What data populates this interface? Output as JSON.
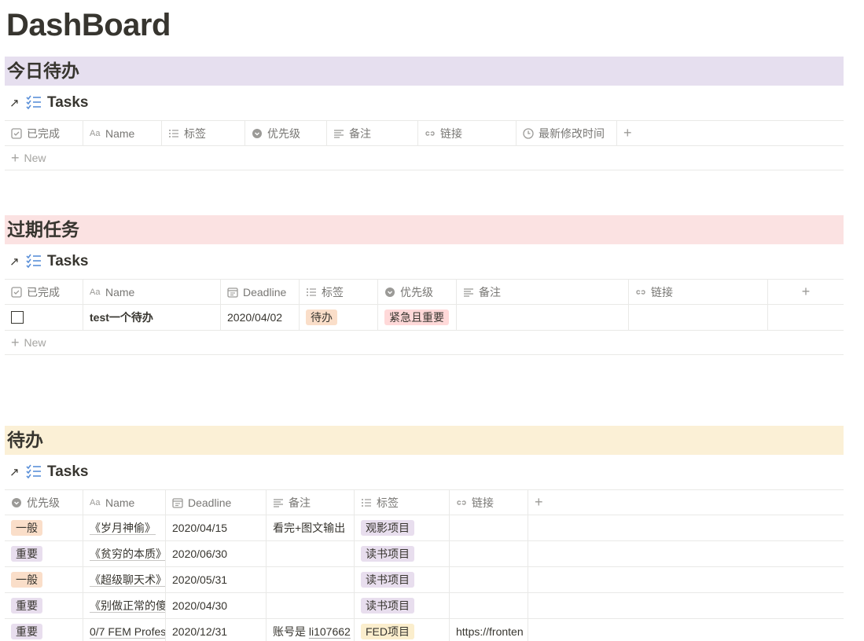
{
  "page_title": "DashBoard",
  "colors": {
    "today_bg": "#e6dfef",
    "overdue_bg": "#fbe2e2",
    "todo_bg": "#fbf0d6",
    "tag_orange": "#fadec9",
    "tag_purple": "#e8deee",
    "tag_pink": "#ffd9d9",
    "tag_yellow": "#fbeecd"
  },
  "sections": {
    "today": {
      "header": "今日待办",
      "db_title": "Tasks",
      "columns": [
        "已完成",
        "Name",
        "标签",
        "优先级",
        "备注",
        "链接",
        "最新修改时间"
      ],
      "new_label": "New"
    },
    "overdue": {
      "header": "过期任务",
      "db_title": "Tasks",
      "columns": [
        "已完成",
        "Name",
        "Deadline",
        "标签",
        "优先级",
        "备注",
        "链接"
      ],
      "rows": [
        {
          "done": false,
          "name": "test一个待办",
          "deadline": "2020/04/02",
          "tag": "待办",
          "priority": "紧急且重要",
          "note": "",
          "link": ""
        }
      ],
      "new_label": "New"
    },
    "todo": {
      "header": "待办",
      "db_title": "Tasks",
      "columns": [
        "优先级",
        "Name",
        "Deadline",
        "备注",
        "标签",
        "链接"
      ],
      "rows": [
        {
          "priority": "一般",
          "name": "《岁月神偷》",
          "deadline": "2020/04/15",
          "note": "看完+图文输出",
          "note_link": "",
          "tag": "观影项目",
          "link": ""
        },
        {
          "priority": "重要",
          "name": "《贫穷的本质》",
          "deadline": "2020/06/30",
          "note": "",
          "note_link": "",
          "tag": "读书项目",
          "link": ""
        },
        {
          "priority": "一般",
          "name": "《超级聊天术》",
          "deadline": "2020/05/31",
          "note": "",
          "note_link": "",
          "tag": "读书项目",
          "link": ""
        },
        {
          "priority": "重要",
          "name": "《别做正常的傻",
          "deadline": "2020/04/30",
          "note": "",
          "note_link": "",
          "tag": "读书项目",
          "link": ""
        },
        {
          "priority": "重要",
          "name": "0/7 FEM Profes",
          "deadline": "2020/12/31",
          "note": "账号是 ",
          "note_link": "li107662",
          "tag": "FED项目",
          "link": "https://fronten"
        }
      ]
    }
  }
}
